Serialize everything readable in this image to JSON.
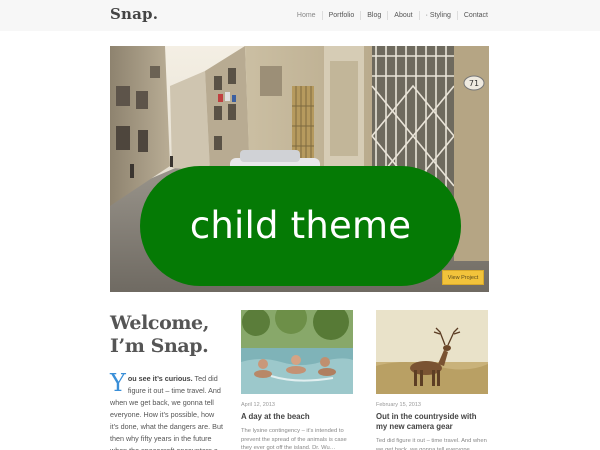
{
  "header": {
    "logo": "Snap.",
    "nav": [
      {
        "label": "Home",
        "active": true
      },
      {
        "label": "Portfolio"
      },
      {
        "label": "Blog"
      },
      {
        "label": "About"
      },
      {
        "label": "· Styling"
      },
      {
        "label": "Contact"
      }
    ]
  },
  "hero": {
    "button_label": "View Project",
    "sign_text": "71",
    "overlay_text": "child theme"
  },
  "welcome": {
    "title_line1": "Welcome,",
    "title_line2": "I’m Snap.",
    "dropcap": "Y",
    "lead": "ou see it’s curious.",
    "body": " Ted did figure it out – time travel. And when we get back, we gonna tell everyone. How it’s possible, how it’s done, what the dangers are. But then why fifty years in the future when the spacecraft encounters a"
  },
  "posts": [
    {
      "date": "April 12, 2013",
      "title": "A day at the beach",
      "excerpt": "The lysine contingency – it’s intended to prevent the spread of the animals is case they ever got off the island. Dr. Wu…"
    },
    {
      "date": "February 15, 2013",
      "title": "Out in the countryside with my new camera gear",
      "excerpt": "Ted did figure it out – time travel. And when we get back, we gonna tell everyone…"
    }
  ],
  "colors": {
    "accent_blue": "#3a8fd8",
    "button_yellow": "#f2c33b",
    "badge_green": "#057a05"
  }
}
